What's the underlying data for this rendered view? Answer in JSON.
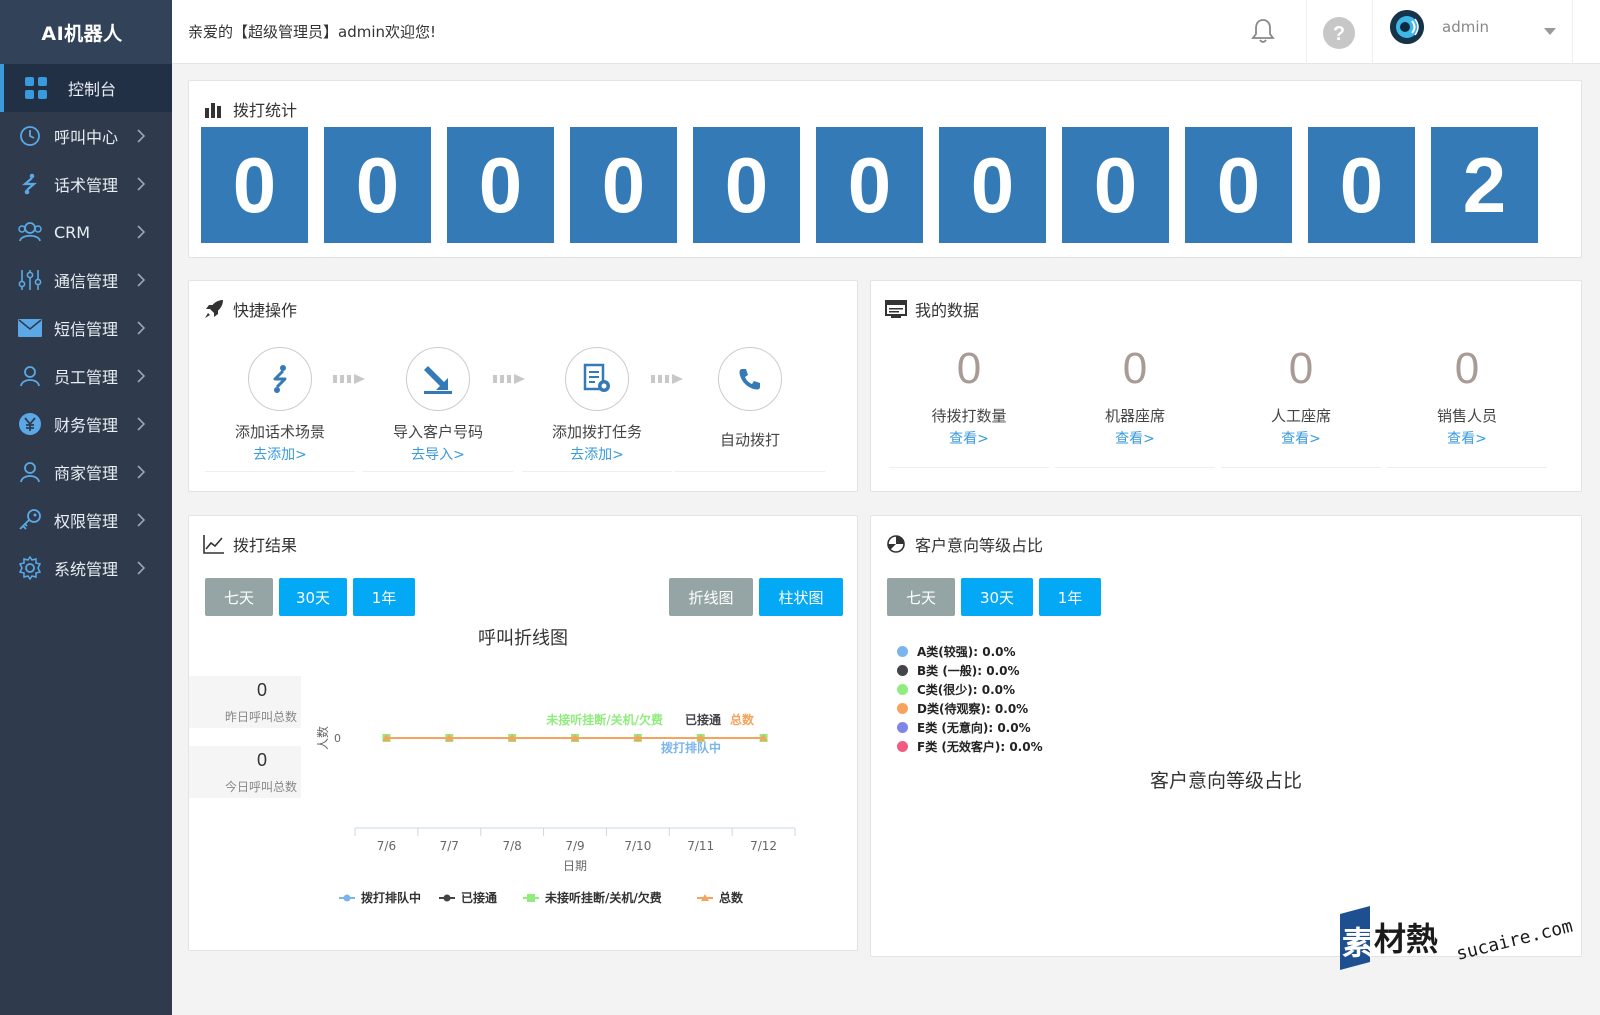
{
  "sidebar": {
    "brand": "AI机器人",
    "items": [
      {
        "label": "控制台",
        "icon": "grid-icon",
        "active": true
      },
      {
        "label": "呼叫中心",
        "icon": "clock-icon"
      },
      {
        "label": "话术管理",
        "icon": "route-icon"
      },
      {
        "label": "CRM",
        "icon": "users-icon"
      },
      {
        "label": "通信管理",
        "icon": "sliders-icon"
      },
      {
        "label": "短信管理",
        "icon": "envelope-icon"
      },
      {
        "label": "员工管理",
        "icon": "user-icon"
      },
      {
        "label": "财务管理",
        "icon": "yen-icon"
      },
      {
        "label": "商家管理",
        "icon": "user-icon"
      },
      {
        "label": "权限管理",
        "icon": "key-icon"
      },
      {
        "label": "系统管理",
        "icon": "gear-icon"
      }
    ]
  },
  "header": {
    "welcome": "亲爱的【超级管理员】admin欢迎您!",
    "username": "admin"
  },
  "stats": {
    "title": "拨打统计",
    "digits": [
      "0",
      "0",
      "0",
      "0",
      "0",
      "0",
      "0",
      "0",
      "0",
      "0",
      "2"
    ]
  },
  "quick_ops": {
    "title": "快捷操作",
    "items": [
      {
        "label": "添加话术场景",
        "link": "去添加>",
        "icon": "route-icon"
      },
      {
        "label": "导入客户号码",
        "link": "去导入>",
        "icon": "import-icon"
      },
      {
        "label": "添加拨打任务",
        "link": "去添加>",
        "icon": "task-gear-icon"
      },
      {
        "label": "自动拨打",
        "link": "",
        "icon": "phone-icon"
      }
    ]
  },
  "my_data": {
    "title": "我的数据",
    "items": [
      {
        "value": "0",
        "label": "待拨打数量",
        "link": "查看>"
      },
      {
        "value": "0",
        "label": "机器座席",
        "link": "查看>"
      },
      {
        "value": "0",
        "label": "人工座席",
        "link": "查看>"
      },
      {
        "value": "0",
        "label": "销售人员",
        "link": "查看>"
      }
    ]
  },
  "call_results": {
    "title": "拨打结果",
    "range_buttons": [
      "七天",
      "30天",
      "1年"
    ],
    "type_buttons": [
      "折线图",
      "柱状图"
    ],
    "chart_title": "呼叫折线图",
    "yesterday": {
      "value": "0",
      "label": "昨日呼叫总数"
    },
    "today": {
      "value": "0",
      "label": "今日呼叫总数"
    }
  },
  "intent": {
    "title": "客户意向等级占比",
    "range_buttons": [
      "七天",
      "30天",
      "1年"
    ],
    "legend": [
      {
        "label": "A类(较强): 0.0%",
        "color": "#7cb5ec"
      },
      {
        "label": "B类 (一般): 0.0%",
        "color": "#434348"
      },
      {
        "label": "C类(很少): 0.0%",
        "color": "#90ed7d"
      },
      {
        "label": "D类(待观察): 0.0%",
        "color": "#f7a35c"
      },
      {
        "label": "E类 (无意向): 0.0%",
        "color": "#8085e9"
      },
      {
        "label": "F类 (无效客户): 0.0%",
        "color": "#f15c80"
      }
    ],
    "caption": "客户意向等级占比"
  },
  "chart_data": {
    "type": "line",
    "x": [
      "7/6",
      "7/7",
      "7/8",
      "7/9",
      "7/10",
      "7/11",
      "7/12"
    ],
    "xlabel": "日期",
    "ylabel": "人数",
    "yticks": [
      "0"
    ],
    "series": [
      {
        "name": "拨打排队中",
        "values": [
          0,
          0,
          0,
          0,
          0,
          0,
          0
        ],
        "color": "#7cb5ec"
      },
      {
        "name": "已接通",
        "values": [
          0,
          0,
          0,
          0,
          0,
          0,
          0
        ],
        "color": "#434348"
      },
      {
        "name": "未接听挂断/关机/欠费",
        "values": [
          0,
          0,
          0,
          0,
          0,
          0,
          0
        ],
        "color": "#90ed7d"
      },
      {
        "name": "总数",
        "values": [
          0,
          0,
          0,
          0,
          0,
          0,
          0
        ],
        "color": "#f7a35c"
      }
    ],
    "legend_position": "bottom"
  },
  "watermark": {
    "cn": "素材熱",
    "en": "sucaire.com"
  }
}
